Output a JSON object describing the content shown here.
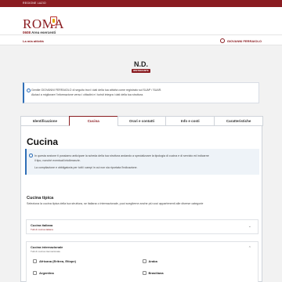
{
  "topbar": {
    "label": "REGIONE LAZIO"
  },
  "logo": {
    "word": "ROMA",
    "code": "0608",
    "sub": "Area esercenti"
  },
  "nav": {
    "left": "La mia attività",
    "user": "GIOVANNI FERRAIOLO"
  },
  "page": {
    "title": "N.D.",
    "badge": "RISTORANTE"
  },
  "info": {
    "line1": "Gentile GIOVANNI FERRAIOLO di seguito trovi i dati della tua attività come registrato sul SUAP / SUAR.",
    "line2": "Aiutaci a migliorare l'informazione verso i cittadini e i turisti integra i dati della tua struttura."
  },
  "tabs": [
    "Identificazione",
    "Cucina",
    "Orari e contatti",
    "Info e costi",
    "Caratteristiche"
  ],
  "cucina": {
    "title": "Cucina",
    "alert1": "In questa sezione ti possiamo anticipare la scheda della tua struttura andando a specializzare la tipologia di cucina e di servizio ed indicarne",
    "alert1b": "il tipo, nonché eventuali intolleranzie.",
    "alert2": "La compilazione e obbligatoria per tutti i campi in cui non sia riportata l'indicazione.",
    "sub_title": "Cucina tipica",
    "sub_desc": "Seleziona la cucina tipica della tua struttura, se italiana o internazionale, puoi sceglierne anche più voci appartenenti alle diverse categorie",
    "acc1": {
      "title": "Cucina italiana",
      "sub": "Tutti di cucina italiana"
    },
    "acc2": {
      "title": "Cucina internazionale",
      "sub": "Tutti di cucina internazionale"
    },
    "options": [
      "Africana (Eritrea, Etiope)",
      "Araba",
      "Argentina",
      "Brasiliana"
    ]
  }
}
